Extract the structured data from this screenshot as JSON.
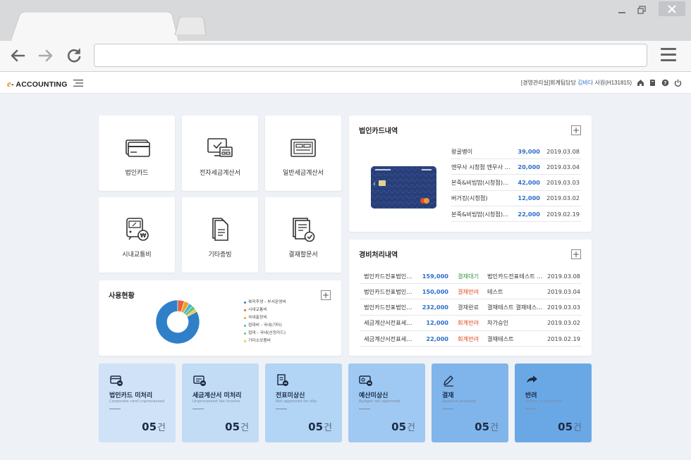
{
  "header": {
    "logo_e": "e",
    "logo_text": "- ACCOUNTING",
    "user_dept": "[경영관리실]회계팀담당",
    "user_name": "김바다",
    "user_title": "사원(H131815)"
  },
  "tiles": [
    {
      "label": "법인카드",
      "icon": "credit-card-icon"
    },
    {
      "label": "전자세금계산서",
      "icon": "e-tax-invoice-icon"
    },
    {
      "label": "일반세금계산서",
      "icon": "tax-invoice-icon"
    },
    {
      "label": "시내교통비",
      "icon": "transit-icon"
    },
    {
      "label": "기타증빙",
      "icon": "documents-icon"
    },
    {
      "label": "결재할문서",
      "icon": "approval-document-icon"
    }
  ],
  "card_history": {
    "title": "법인카드내역",
    "plus": "+",
    "rows": [
      {
        "merchant": "왕골뱅이",
        "amount": "39,000",
        "date": "2019.03.08"
      },
      {
        "merchant": "엔무사 시청점 엔무사 시...",
        "amount": "20,000",
        "date": "2019.03.04"
      },
      {
        "merchant": "본죽&비빔밥(시청점)본...",
        "amount": "42,000",
        "date": "2019.03.03"
      },
      {
        "merchant": "버거킹(시청점)",
        "amount": "12,000",
        "date": "2019.03.02"
      },
      {
        "merchant": "본죽&비빔밥(시청점)본...",
        "amount": "22,000",
        "date": "2019.02.19"
      }
    ]
  },
  "expense_history": {
    "title": "경비처리내역",
    "plus": "+",
    "rows": [
      {
        "doc": "법인카드전표법인카...",
        "amount": "159,000",
        "status": "결재대기",
        "status_type": "wait",
        "desc": "법인카드전표테스트 법...",
        "date": "2019.03.08"
      },
      {
        "doc": "법인카드전표법인카...",
        "amount": "150,000",
        "status": "결재반려",
        "status_type": "return",
        "desc": "테스트",
        "date": "2019.03.04"
      },
      {
        "doc": "법인카드전표법인카...",
        "amount": "232,000",
        "status": "결재완료",
        "status_type": "done",
        "desc": "결재테스트 결재테스트...",
        "date": "2019.03.03"
      },
      {
        "doc": "세금계산서전표세금...",
        "amount": "12,000",
        "status": "회계반려",
        "status_type": "return",
        "desc": "자가승인",
        "date": "2019.03.02"
      },
      {
        "doc": "세금계산서전표세금...",
        "amount": "22,000",
        "status": "회계반려",
        "status_type": "return",
        "desc": "결재테스트",
        "date": "2019.02.19"
      }
    ]
  },
  "usage": {
    "title": "사용현황",
    "plus": "+",
    "legend": [
      {
        "label": "복리후생 - 부서운영비",
        "color": "#2f80c8"
      },
      {
        "label": "시내교통비",
        "color": "#e8603c"
      },
      {
        "label": "국내출장비",
        "color": "#f0a030"
      },
      {
        "label": "접대비 - 국내(기타)",
        "color": "#3bb8d8"
      },
      {
        "label": "접대 - 국내(선정카드)",
        "color": "#6cc07a"
      },
      {
        "label": "기타소모품비",
        "color": "#f3c23a"
      }
    ],
    "chart_data": {
      "type": "pie",
      "categories": [
        "복리후생 - 부서운영비",
        "시내교통비",
        "국내출장비",
        "접대비 - 국내(기타)",
        "접대 - 국내(선정카드)",
        "기타소모품비"
      ],
      "values": [
        83,
        5,
        4,
        3,
        3,
        2
      ]
    }
  },
  "stats": [
    {
      "title": "법인카드 미처리",
      "sub": "Corporate card unprocessed",
      "count": "05",
      "unit": "건",
      "icon": "credit-card-icon",
      "bg": "#cfe2f7"
    },
    {
      "title": "세금계산서 미처리",
      "sub": "Unprocessed tax invoice",
      "count": "05",
      "unit": "건",
      "icon": "tax-invoice-icon",
      "bg": "#c2dcf6"
    },
    {
      "title": "전표미상신",
      "sub": "Not approved for slip",
      "count": "05",
      "unit": "건",
      "icon": "slip-icon",
      "bg": "#b2d4f5"
    },
    {
      "title": "예산미상신",
      "sub": "Budget not approved",
      "count": "05",
      "unit": "건",
      "icon": "budget-icon",
      "bg": "#9fc9f2"
    },
    {
      "title": "결재",
      "sub": "Approve proposal",
      "count": "05",
      "unit": "건",
      "icon": "pen-icon",
      "bg": "#7fb5ea"
    },
    {
      "title": "반려",
      "sub": "Return a document",
      "count": "05",
      "unit": "건",
      "icon": "return-arrow-icon",
      "bg": "#6aa8e5"
    }
  ]
}
